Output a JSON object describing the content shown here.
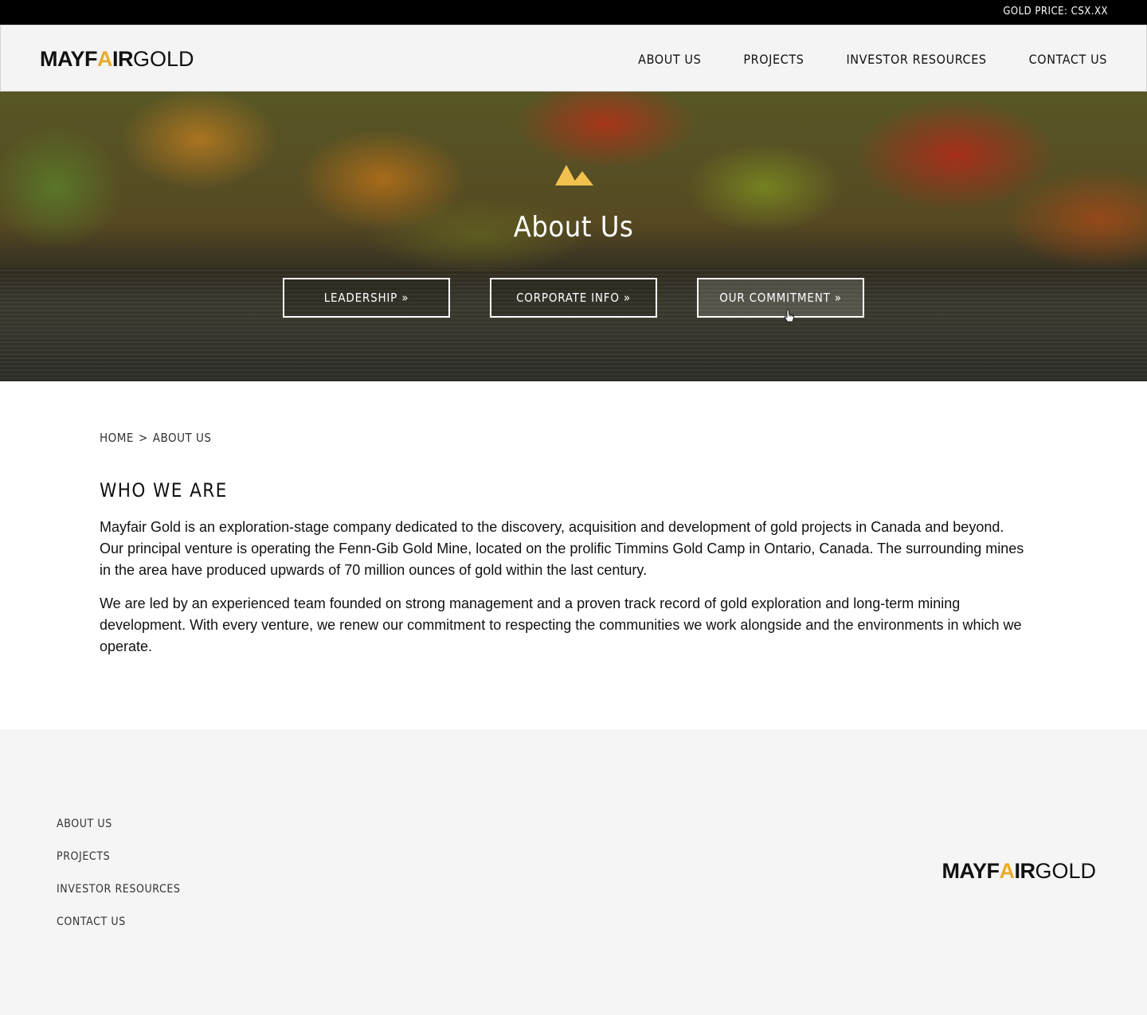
{
  "topbar": {
    "gold_price": "GOLD PRICE: CSX.XX"
  },
  "brand": {
    "logo_bold": "MAYF",
    "logo_a": "A",
    "logo_bold_end": "IR",
    "logo_light": "GOLD",
    "accent": "#e8ad2c"
  },
  "header": {
    "nav": [
      {
        "label": "ABOUT US"
      },
      {
        "label": "PROJECTS"
      },
      {
        "label": "INVESTOR RESOURCES"
      },
      {
        "label": "CONTACT US"
      }
    ]
  },
  "hero": {
    "icon": "mountain-icon",
    "title": "About Us",
    "buttons": [
      {
        "label": "LEADERSHIP »"
      },
      {
        "label": "CORPORATE INFO »"
      },
      {
        "label": "OUR COMMITMENT »"
      }
    ]
  },
  "breadcrumb": {
    "home": "HOME",
    "separator": ">",
    "current": "ABOUT US"
  },
  "content": {
    "heading": "WHO WE ARE",
    "paragraphs": [
      "Mayfair Gold is an exploration-stage company dedicated to the discovery, acquisition and development of gold projects in Canada and beyond. Our principal venture is operating the Fenn-Gib Gold Mine, located on the prolific Timmins Gold Camp in Ontario, Canada. The surrounding mines in the area have produced upwards of 70 million ounces of gold within the last century.",
      "We are led by an experienced team founded on strong management and a proven track record of gold exploration and long-term mining development. With every venture, we renew our commitment to respecting the communities we work alongside and the environments in which we operate."
    ]
  },
  "footer": {
    "nav": [
      {
        "label": "ABOUT US"
      },
      {
        "label": "PROJECTS"
      },
      {
        "label": "INVESTOR RESOURCES"
      },
      {
        "label": "CONTACT US"
      }
    ]
  }
}
